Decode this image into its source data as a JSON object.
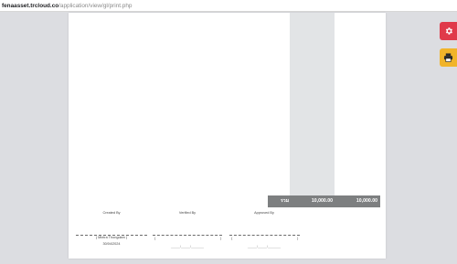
{
  "browser": {
    "url_host": "fenaasset.trcloud.co",
    "url_path": "/application/view/gl/print.php"
  },
  "document": {
    "totals": {
      "label": "รวม",
      "debit": "10,000.00",
      "credit": "10,000.00"
    },
    "signatures": [
      {
        "title": "Created By",
        "name": "( Mintra Thongdam )",
        "date": "30/04/2024",
        "date_placeholder": ""
      },
      {
        "title": "Verified By",
        "name": "",
        "date": "",
        "date_placeholder": "_____/_____/_______"
      },
      {
        "title": "Approved By",
        "name": "",
        "date": "",
        "date_placeholder": "_____/_____/_______"
      }
    ]
  },
  "actions": {
    "settings_icon": "gear-icon",
    "print_icon": "printer-icon",
    "settings_color": "#e03a4a",
    "print_color": "#f1b42a"
  }
}
